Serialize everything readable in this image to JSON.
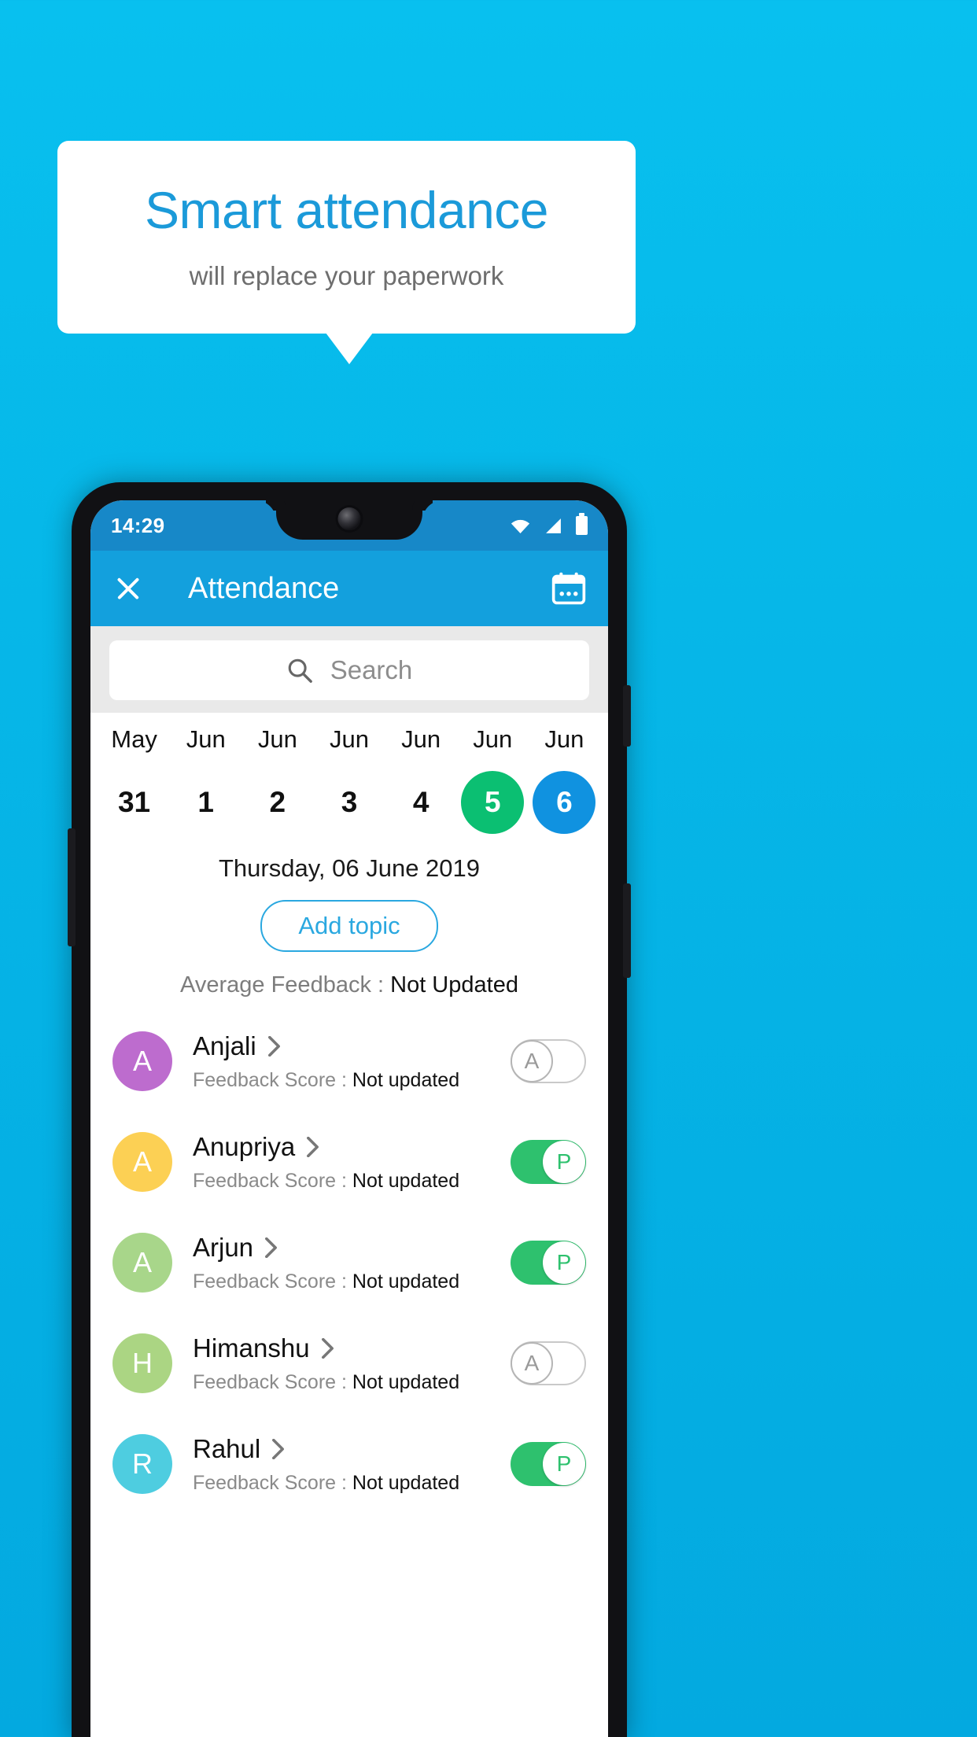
{
  "promo": {
    "title": "Smart attendance",
    "subtitle": "will replace your paperwork",
    "title_color": "#1b9ad9",
    "background_color": "#08c0ef"
  },
  "phone": {
    "status_bar": {
      "time": "14:29",
      "icons": [
        "wifi-icon",
        "signal-icon",
        "battery-icon"
      ]
    },
    "app_bar": {
      "close_icon": "close-icon",
      "title": "Attendance",
      "calendar_icon": "calendar-icon",
      "color": "#13a0dd"
    },
    "search": {
      "placeholder": "Search",
      "icon": "search-icon"
    },
    "calendar_strip": [
      {
        "month": "May",
        "day": "31",
        "state": "normal"
      },
      {
        "month": "Jun",
        "day": "1",
        "state": "normal"
      },
      {
        "month": "Jun",
        "day": "2",
        "state": "normal"
      },
      {
        "month": "Jun",
        "day": "3",
        "state": "normal"
      },
      {
        "month": "Jun",
        "day": "4",
        "state": "normal"
      },
      {
        "month": "Jun",
        "day": "5",
        "state": "green"
      },
      {
        "month": "Jun",
        "day": "6",
        "state": "blue"
      }
    ],
    "selected_date": "Thursday, 06 June 2019",
    "add_topic_label": "Add topic",
    "average_feedback_label": "Average Feedback : ",
    "average_feedback_value": "Not Updated",
    "feedback_label": "Feedback Score : ",
    "students": [
      {
        "initial": "A",
        "name": "Anjali",
        "avatar_color": "#bd6cce",
        "feedback": "Not updated",
        "attendance": "A",
        "present": false
      },
      {
        "initial": "A",
        "name": "Anupriya",
        "avatar_color": "#fcd054",
        "feedback": "Not updated",
        "attendance": "P",
        "present": true
      },
      {
        "initial": "A",
        "name": "Arjun",
        "avatar_color": "#a8d68a",
        "feedback": "Not updated",
        "attendance": "P",
        "present": true
      },
      {
        "initial": "H",
        "name": "Himanshu",
        "avatar_color": "#abd583",
        "feedback": "Not updated",
        "attendance": "A",
        "present": false
      },
      {
        "initial": "R",
        "name": "Rahul",
        "avatar_color": "#4ecde0",
        "feedback": "Not updated",
        "attendance": "P",
        "present": true
      }
    ]
  }
}
